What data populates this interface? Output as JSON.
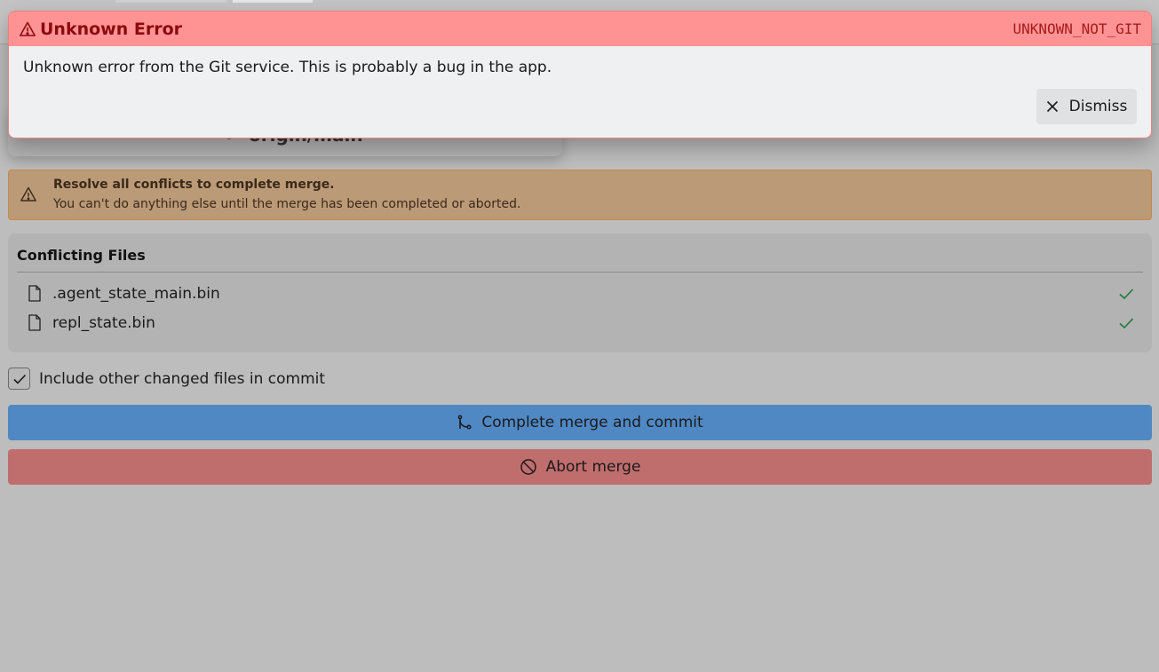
{
  "error": {
    "title": "Unknown Error",
    "code": "UNKNOWN_NOT_GIT",
    "message": "Unknown error from the Git service. This is probably a bug in the app.",
    "dismiss_label": "Dismiss"
  },
  "branch": {
    "name": "origin/main"
  },
  "warning": {
    "title": "Resolve all conflicts to complete merge.",
    "text": "You can't do anything else until the merge has been completed or aborted."
  },
  "conflicts": {
    "title": "Conflicting Files",
    "files": [
      {
        "name": ".agent_state_main.bin",
        "resolved": true
      },
      {
        "name": "repl_state.bin",
        "resolved": true
      }
    ]
  },
  "include_other": {
    "label": "Include other changed files in commit",
    "checked": true
  },
  "actions": {
    "complete_label": "Complete merge and commit",
    "abort_label": "Abort merge"
  },
  "colors": {
    "error_header": "#ff9393",
    "error_text": "#8b0b10",
    "warning_bg": "#bb9a78",
    "complete_button": "#5088c3",
    "abort_button": "#c06d6e",
    "check_green": "#1f7a3a"
  }
}
